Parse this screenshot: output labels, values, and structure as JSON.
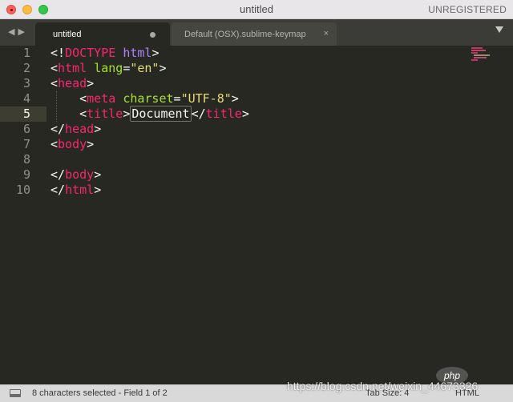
{
  "window": {
    "title": "untitled",
    "license_status": "UNREGISTERED"
  },
  "tabs": [
    {
      "label": "untitled",
      "active": true,
      "modified": true
    },
    {
      "label": "Default (OSX).sublime-keymap",
      "active": false,
      "close_glyph": "×"
    }
  ],
  "nav": {
    "back_glyph": "◀",
    "forward_glyph": "▶"
  },
  "editor": {
    "current_line": 5,
    "line_numbers": [
      "1",
      "2",
      "3",
      "4",
      "5",
      "6",
      "7",
      "8",
      "9",
      "10"
    ],
    "tokens": {
      "l1_a": "<!",
      "l1_b": "DOCTYPE",
      "l1_c": " ",
      "l1_d": "html",
      "l1_e": ">",
      "l2_a": "<",
      "l2_b": "html",
      "l2_c": " ",
      "l2_d": "lang",
      "l2_e": "=",
      "l2_f": "\"en\"",
      "l2_g": ">",
      "l3_a": "<",
      "l3_b": "head",
      "l3_c": ">",
      "l4_indent": "    ",
      "l4_a": "<",
      "l4_b": "meta",
      "l4_c": " ",
      "l4_d": "charset",
      "l4_e": "=",
      "l4_f": "\"UTF-8\"",
      "l4_g": ">",
      "l5_indent": "    ",
      "l5_a": "<",
      "l5_b": "title",
      "l5_c": ">",
      "l5_sel": "Document",
      "l5_d": "</",
      "l5_e": "title",
      "l5_f": ">",
      "l6_a": "</",
      "l6_b": "head",
      "l6_c": ">",
      "l7_a": "<",
      "l7_b": "body",
      "l7_c": ">",
      "l9_a": "</",
      "l9_b": "body",
      "l9_c": ">",
      "l10_a": "</",
      "l10_b": "html",
      "l10_c": ">"
    }
  },
  "statusbar": {
    "selection_text": "8 characters selected - Field 1 of 2",
    "tab_size": "Tab Size: 4",
    "syntax": "HTML"
  },
  "watermark": {
    "text": "https://blog.csdn.net/weixin_44673326",
    "logo_text": "php"
  },
  "colors": {
    "background": "#272822",
    "tag": "#f92672",
    "attribute": "#a6e22e",
    "string": "#e6db74",
    "keyword": "#ae81ff",
    "plain": "#f8f8f2",
    "line_number": "#90908a"
  },
  "icons": {
    "panel_toggle": "panel-icon",
    "tab_menu": "chevron-down-icon",
    "minimap": "minimap-icon"
  }
}
